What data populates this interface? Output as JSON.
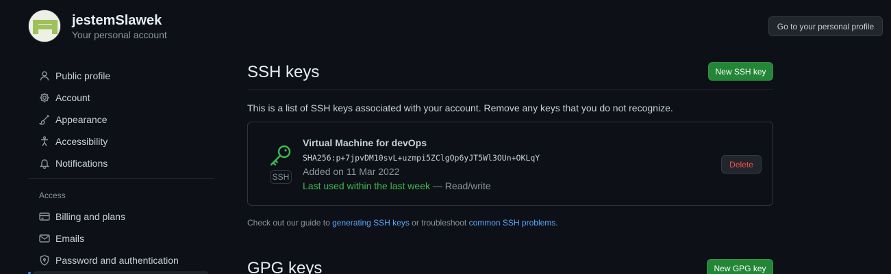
{
  "header": {
    "username": "jestemSlawek",
    "account_type": "Your personal account",
    "profile_button": "Go to your personal profile"
  },
  "sidebar": {
    "items": [
      {
        "label": "Public profile",
        "icon": "person-icon"
      },
      {
        "label": "Account",
        "icon": "gear-icon"
      },
      {
        "label": "Appearance",
        "icon": "paintbrush-icon"
      },
      {
        "label": "Accessibility",
        "icon": "accessibility-icon"
      },
      {
        "label": "Notifications",
        "icon": "bell-icon"
      }
    ],
    "access_heading": "Access",
    "access_items": [
      {
        "label": "Billing and plans",
        "icon": "credit-card-icon"
      },
      {
        "label": "Emails",
        "icon": "mail-icon"
      },
      {
        "label": "Password and authentication",
        "icon": "shield-lock-icon"
      }
    ]
  },
  "ssh": {
    "title": "SSH keys",
    "new_button": "New SSH key",
    "intro": "This is a list of SSH keys associated with your account. Remove any keys that you do not recognize.",
    "key": {
      "name": "Virtual Machine for devOps",
      "fingerprint": "SHA256:p+7jpvDM10svL+uzmpi5ZClgOp6yJT5Wl3OUn+OKLqY",
      "added": "Added on 11 Mar 2022",
      "last_used": "Last used within the last week",
      "access": "— Read/write",
      "badge": "SSH",
      "delete_button": "Delete"
    },
    "guide": {
      "prefix": "Check out our guide to",
      "link1": "generating SSH keys",
      "middle": "or troubleshoot",
      "link2": "common SSH problems",
      "suffix": "."
    }
  },
  "gpg": {
    "title": "GPG keys",
    "new_button": "New GPG key"
  },
  "colors": {
    "background": "#0d1117",
    "primary_button": "#238636",
    "danger": "#f85149",
    "success": "#3fb950",
    "link": "#58a6ff"
  }
}
